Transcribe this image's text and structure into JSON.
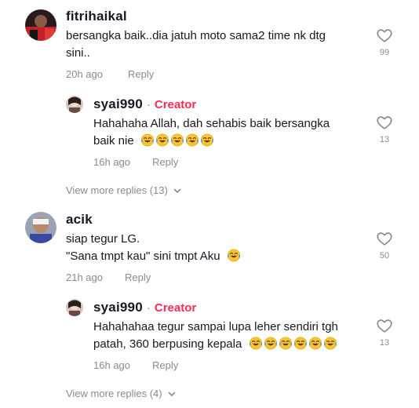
{
  "comments": [
    {
      "username": "fitrihaikal",
      "text_line1": "bersangka baik..dia jatuh moto sama2 time nk dtg",
      "text_line2": "sini..",
      "time": "20h ago",
      "reply_label": "Reply",
      "likes": "99",
      "replies": [
        {
          "username": "syai990",
          "separator": "·",
          "badge": "Creator",
          "text_line1": "Hahahaha Allah, dah sehabis baik bersangka",
          "text_line2": "baik nie",
          "emoji_count": 5,
          "time": "16h ago",
          "reply_label": "Reply",
          "likes": "13"
        }
      ],
      "view_more": "View more replies (13)"
    },
    {
      "username": "acik",
      "text_line1": "siap tegur LG.",
      "text_line2": "\"Sana tmpt kau\" sini tmpt Aku",
      "emoji_count": 1,
      "time": "21h ago",
      "reply_label": "Reply",
      "likes": "50",
      "replies": [
        {
          "username": "syai990",
          "separator": "·",
          "badge": "Creator",
          "text_line1": "Hahahahaa tegur sampai lupa leher sendiri tgh",
          "text_line2": "patah, 360 berpusing kepala",
          "emoji_count": 6,
          "time": "16h ago",
          "reply_label": "Reply",
          "likes": "13"
        }
      ],
      "view_more": "View more replies (4)"
    }
  ],
  "icons": {
    "like": "heart-outline-icon",
    "expand": "chevron-down-icon",
    "emoji": "face-with-tears-of-joy-emoji"
  },
  "colors": {
    "creator_badge": "#fe2c55",
    "meta_gray": "#8a8b91",
    "text": "#161823"
  }
}
